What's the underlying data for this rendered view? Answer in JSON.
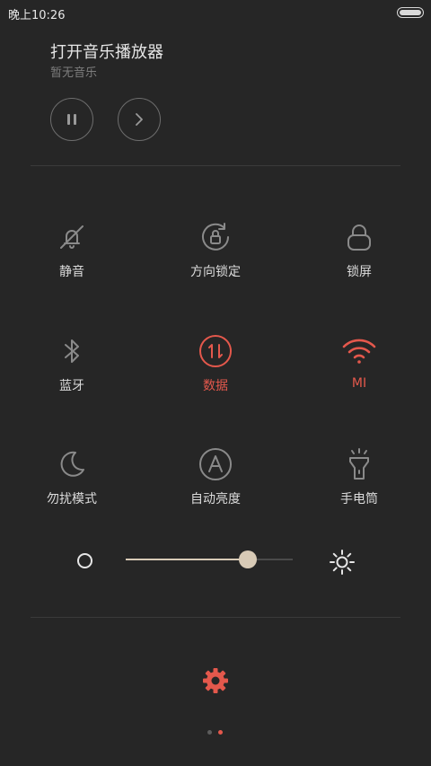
{
  "status_bar": {
    "time": "晚上10:26"
  },
  "music": {
    "title": "打开音乐播放器",
    "subtitle": "暂无音乐"
  },
  "toggles": [
    {
      "label": "静音",
      "icon": "bell-off-icon",
      "active": false
    },
    {
      "label": "方向锁定",
      "icon": "rotation-lock-icon",
      "active": false
    },
    {
      "label": "锁屏",
      "icon": "lock-icon",
      "active": false
    },
    {
      "label": "蓝牙",
      "icon": "bluetooth-icon",
      "active": false
    },
    {
      "label": "数据",
      "icon": "mobile-data-icon",
      "active": true
    },
    {
      "label": "MI",
      "icon": "wifi-icon",
      "active": true
    },
    {
      "label": "勿扰模式",
      "icon": "moon-icon",
      "active": false
    },
    {
      "label": "自动亮度",
      "icon": "auto-brightness-icon",
      "active": false
    },
    {
      "label": "手电筒",
      "icon": "flashlight-icon",
      "active": false
    }
  ],
  "brightness": {
    "value": 0.73
  },
  "pager": {
    "pages": 2,
    "current": 2
  },
  "colors": {
    "accent": "#e4584c",
    "icon": "#8a8a8a",
    "thumb": "#d8cab6",
    "background": "#262626"
  }
}
